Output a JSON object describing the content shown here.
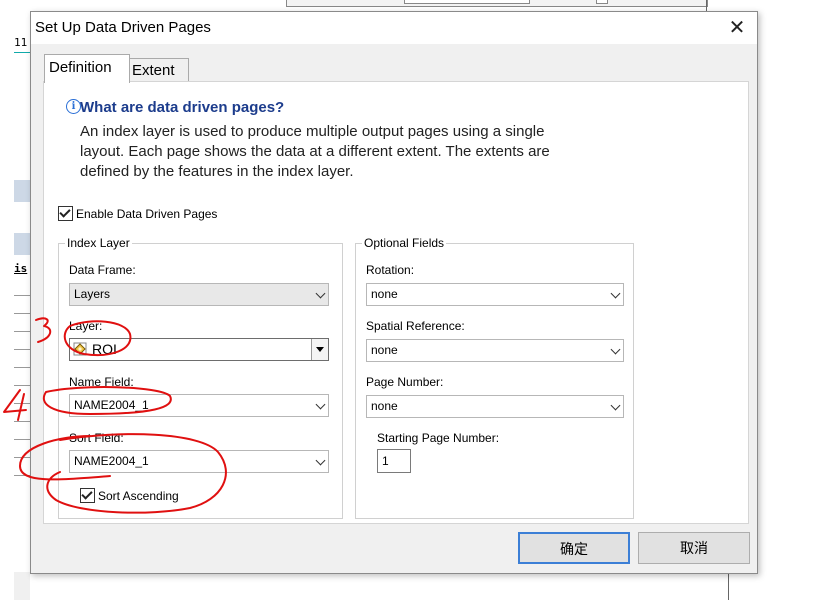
{
  "background": {
    "left_text": "11",
    "left_label": "is"
  },
  "dialog": {
    "title": "Set Up Data Driven Pages",
    "close_glyph": "✕",
    "tabs": [
      {
        "label": "Definition",
        "active": true
      },
      {
        "label": "Extent",
        "active": false
      }
    ],
    "info": {
      "icon_glyph": "i",
      "heading": "What are data driven pages?",
      "lines": [
        "An index layer is used to produce multiple output pages using a single",
        "layout.  Each page shows the data at a different extent.  The extents are",
        "defined by the features in the index layer."
      ]
    },
    "enable": {
      "label": "Enable Data Driven Pages",
      "checked": true
    },
    "index_layer": {
      "legend": "Index Layer",
      "data_frame": {
        "label": "Data Frame:",
        "value": "Layers"
      },
      "layer": {
        "label": "Layer:",
        "value": "ROI"
      },
      "name_field": {
        "label": "Name Field:",
        "value": "NAME2004_1"
      },
      "sort_field": {
        "label": "Sort Field:",
        "value": "NAME2004_1"
      },
      "sort_ascending": {
        "label": "Sort Ascending",
        "checked": true
      }
    },
    "optional_fields": {
      "legend": "Optional Fields",
      "rotation": {
        "label": "Rotation:",
        "value": "none"
      },
      "spatial_reference": {
        "label": "Spatial Reference:",
        "value": "none"
      },
      "page_number": {
        "label": "Page Number:",
        "value": "none"
      },
      "starting_page_number": {
        "label": "Starting Page Number:",
        "value": "1"
      }
    },
    "buttons": {
      "ok": "确定",
      "cancel": "取消"
    }
  },
  "colors": {
    "annotation": "#e01010",
    "heading": "#1c3c8c",
    "ok_border": "#3c7fd6"
  }
}
